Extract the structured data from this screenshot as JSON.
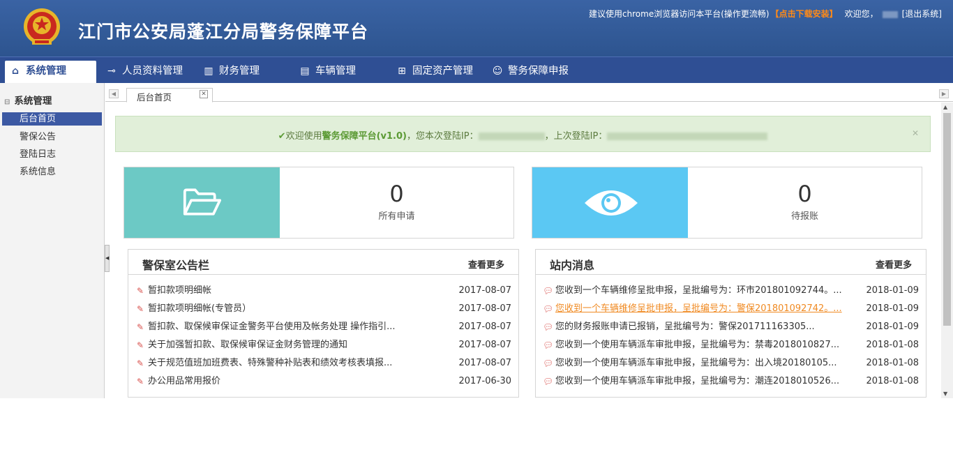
{
  "header": {
    "title": "江门市公安局蓬江分局警务保障平台",
    "browser_hint": "建议使用chrome浏览器访问本平台(操作更流畅)",
    "download_link": "【点击下载安装】",
    "welcome": "欢迎您，",
    "logout": "[退出系统]"
  },
  "nav": {
    "items": [
      {
        "label": "系统管理",
        "icon": "home-icon"
      },
      {
        "label": "人员资料管理",
        "icon": "key-icon"
      },
      {
        "label": "财务管理",
        "icon": "bar-chart-icon"
      },
      {
        "label": "车辆管理",
        "icon": "list-icon"
      },
      {
        "label": "固定资产管理",
        "icon": "grid-icon"
      },
      {
        "label": "警务保障申报",
        "icon": "users-icon"
      }
    ]
  },
  "sidebar": {
    "heading": "系统管理",
    "items": [
      {
        "label": "后台首页"
      },
      {
        "label": "警保公告"
      },
      {
        "label": "登陆日志"
      },
      {
        "label": "系统信息"
      }
    ]
  },
  "tabs": {
    "items": [
      {
        "label": "后台首页"
      }
    ]
  },
  "welcome": {
    "prefix": "欢迎使用",
    "platform": "警务保障平台(v1.0)",
    "this_login": "，您本次登陆IP：",
    "last_login": "，上次登陆IP："
  },
  "stats": [
    {
      "value": "0",
      "label": "所有申请",
      "color": "#6cc9c5",
      "icon": "folder-open-icon"
    },
    {
      "value": "0",
      "label": "待报账",
      "color": "#5bc8f3",
      "icon": "eye-icon"
    }
  ],
  "notices": {
    "title": "警保室公告栏",
    "more": "查看更多",
    "rows": [
      {
        "title": "暂扣款项明细帐",
        "date": "2017-08-07"
      },
      {
        "title": "暂扣款项明细帐(专管员）",
        "date": "2017-08-07"
      },
      {
        "title": "暂扣款、取保候审保证金警务平台使用及帐务处理 操作指引...",
        "date": "2017-08-07"
      },
      {
        "title": "关于加强暂扣款、取保候审保证金财务管理的通知",
        "date": "2017-08-07"
      },
      {
        "title": "关于规范值班加班费表、特殊警种补贴表和绩效考核表填报...",
        "date": "2017-08-07"
      },
      {
        "title": "办公用品常用报价",
        "date": "2017-06-30"
      }
    ]
  },
  "messages": {
    "title": "站内消息",
    "more": "查看更多",
    "rows": [
      {
        "title": "您收到一个车辆维修呈批申报，呈批编号为：环市201801092744。...",
        "date": "2018-01-09"
      },
      {
        "title": "您收到一个车辆维修呈批申报，呈批编号为：警保201801092742。...",
        "date": "2018-01-09"
      },
      {
        "title": "您的财务报账申请已报销，呈批编号为：警保201711163305...",
        "date": "2018-01-09"
      },
      {
        "title": "您收到一个使用车辆派车审批申报，呈批编号为：禁毒2018010827...",
        "date": "2018-01-08"
      },
      {
        "title": "您收到一个使用车辆派车审批申报，呈批编号为：出入境20180105...",
        "date": "2018-01-08"
      },
      {
        "title": "您收到一个使用车辆派车审批申报，呈批编号为：潮连2018010526...",
        "date": "2018-01-08"
      }
    ]
  }
}
